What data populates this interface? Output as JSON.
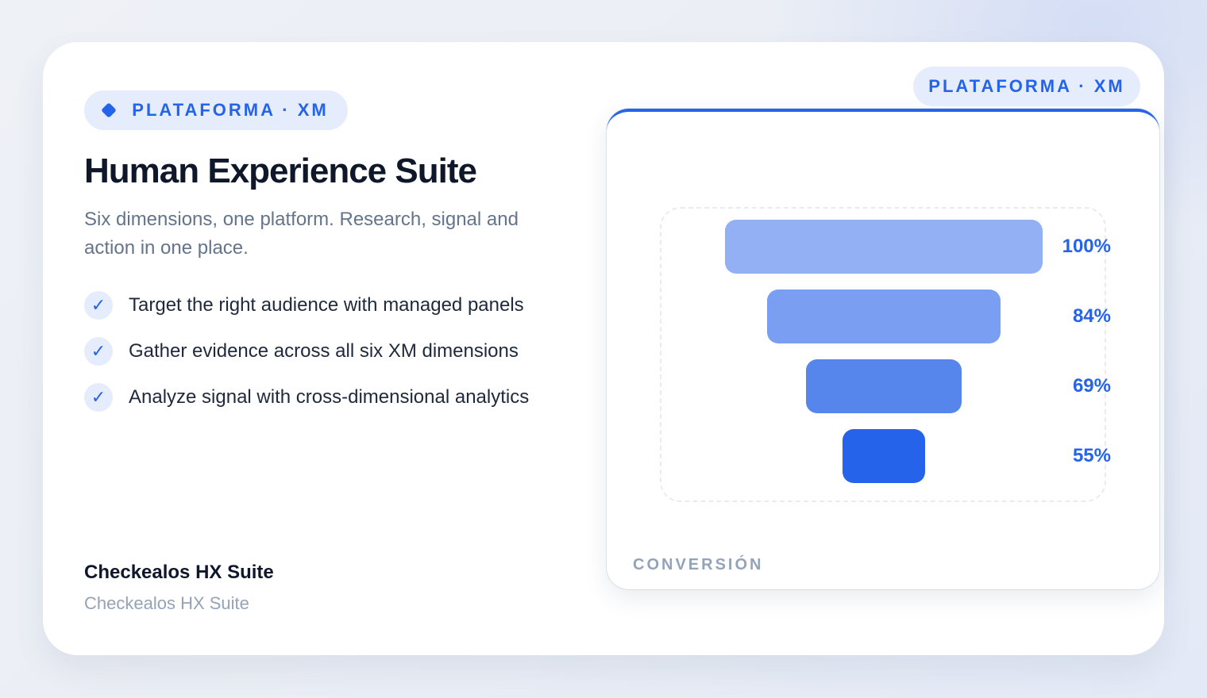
{
  "badge": {
    "label": "PLATAFORMA · XM"
  },
  "hero": {
    "title": "Human Experience Suite",
    "subtitle": "Six dimensions, one platform. Research, signal and action in one place.",
    "features": [
      {
        "icon": "check-icon",
        "text": "Target the right audience with managed panels"
      },
      {
        "icon": "check-icon",
        "text": "Gather evidence across all six XM dimensions"
      },
      {
        "icon": "check-icon",
        "text": "Analyze signal with cross-dimensional analytics"
      }
    ]
  },
  "footer": {
    "title": "Checkealos HX Suite",
    "subtitle": "Checkealos HX Suite"
  },
  "panel": {
    "badge": "PLATAFORMA · XM",
    "caption": "CONVERSIÓN"
  },
  "colors": {
    "accent": "#2563eb",
    "pill_bg": "#e5ecfb",
    "funnel": [
      "#93b0f4",
      "#7a9ef2",
      "#5686ec",
      "#2563eb"
    ]
  },
  "chart_data": {
    "type": "funnel",
    "values": [
      100,
      84,
      69,
      55
    ],
    "labels": [
      "100%",
      "84%",
      "69%",
      "55%"
    ]
  }
}
